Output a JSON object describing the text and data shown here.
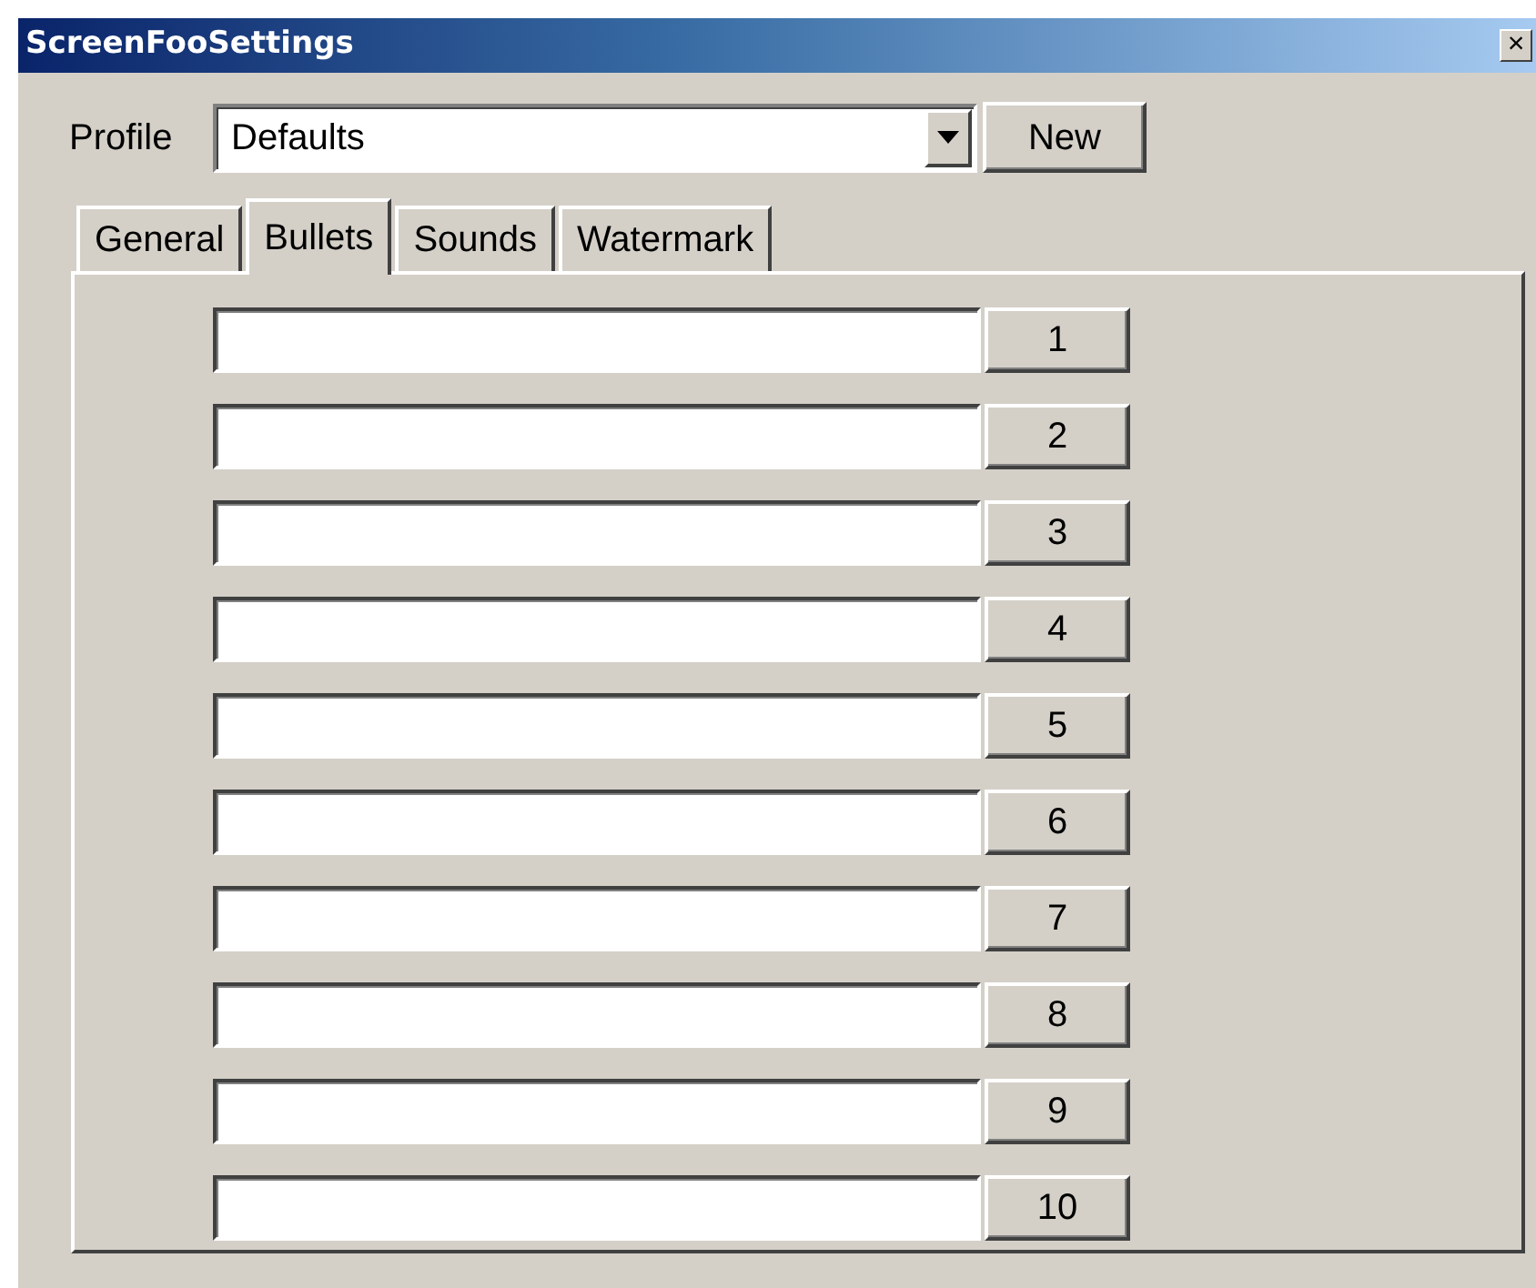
{
  "window": {
    "title": "ScreenFooSettings",
    "close": "×"
  },
  "profile": {
    "label": "Profile",
    "value": "Defaults",
    "button": "New"
  },
  "tabs": [
    {
      "label": "General",
      "selected": false
    },
    {
      "label": "Bullets",
      "selected": true
    },
    {
      "label": "Sounds",
      "selected": false
    },
    {
      "label": "Watermark",
      "selected": false
    }
  ],
  "bullets": [
    {
      "button": "1"
    },
    {
      "button": "2"
    },
    {
      "button": "3"
    },
    {
      "button": "4"
    },
    {
      "button": "5"
    },
    {
      "button": "6"
    },
    {
      "button": "7"
    },
    {
      "button": "8"
    },
    {
      "button": "9"
    },
    {
      "button": "10"
    }
  ]
}
